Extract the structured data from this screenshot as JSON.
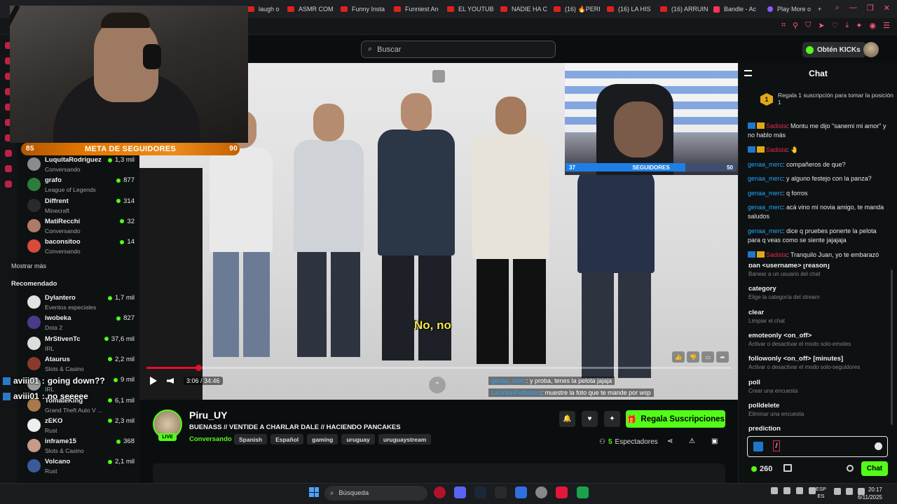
{
  "browser": {
    "tabs": [
      {
        "label": "laugh o",
        "icon": "youtube-icon"
      },
      {
        "label": "ASMR COM",
        "icon": "youtube-icon"
      },
      {
        "label": "Funny Insta",
        "icon": "youtube-icon"
      },
      {
        "label": "Funniest An",
        "icon": "youtube-icon"
      },
      {
        "label": "EL YOUTUB",
        "icon": "youtube-icon"
      },
      {
        "label": "NADIE HA C",
        "icon": "youtube-icon"
      },
      {
        "label": "(16) 🔥PERI",
        "icon": "youtube-icon"
      },
      {
        "label": "(16) LA HIS",
        "icon": "youtube-icon"
      },
      {
        "label": "(16) ARRUIN",
        "icon": "youtube-icon"
      },
      {
        "label": "Bandle - Ac",
        "icon": "bandle-icon"
      },
      {
        "label": "Play More o",
        "icon": "play-icon"
      }
    ],
    "new_tab": "+"
  },
  "header": {
    "search_placeholder": "Buscar",
    "kicks_button": "Obtén KICKs"
  },
  "overlay": {
    "goal_label": "META DE SEGUIDORES",
    "goal_current": "85",
    "goal_target": "90",
    "chat_lines": [
      {
        "user": "aviii01",
        "text": "going down??"
      },
      {
        "user": "aviii01",
        "text": "no seeeee"
      }
    ]
  },
  "sidebar": {
    "following": [
      {
        "name": "LuquitaRodriguez",
        "category": "Conversando",
        "viewers": "1,3 mil"
      },
      {
        "name": "grafo",
        "category": "League of Legends",
        "viewers": "877"
      },
      {
        "name": "Diffrent",
        "category": "Minecraft",
        "viewers": "314"
      },
      {
        "name": "MatiRecchi",
        "category": "Conversando",
        "viewers": "32"
      },
      {
        "name": "baconsitoo",
        "category": "Conversando",
        "viewers": "14"
      }
    ],
    "show_more": "Mostrar más",
    "recommended_title": "Recomendado",
    "recommended": [
      {
        "name": "Dylantero",
        "category": "Eventos especiales",
        "viewers": "1,7 mil"
      },
      {
        "name": "iwobeka",
        "category": "Dota 2",
        "viewers": "827"
      },
      {
        "name": "MrStivenTc",
        "category": "IRL",
        "viewers": "37,6 mil"
      },
      {
        "name": "Ataurus",
        "category": "Slots & Casino",
        "viewers": "2,2 mil"
      },
      {
        "name": "",
        "category": "IRL",
        "viewers": "9 mil"
      },
      {
        "name": "TomateKing",
        "category": "Grand Theft Auto V ...",
        "viewers": "6,1 mil"
      },
      {
        "name": "zEKO",
        "category": "Rust",
        "viewers": "2,3 mil"
      },
      {
        "name": "inframe15",
        "category": "Slots & Casino",
        "viewers": "368"
      },
      {
        "name": "Volcano",
        "category": "Rust",
        "viewers": "2,1 mil"
      }
    ]
  },
  "video": {
    "subtitle": "No, no",
    "time": "3:06 / 34:46",
    "progress": 0.089,
    "pip_label": "SEGUIDORES",
    "pip_low": "37",
    "pip_high": "50",
    "pip_fill": 0.7,
    "chat_lines": [
      {
        "user": "genaa_merc",
        "text": ": y proba, tenes la pelota jajaja"
      },
      {
        "user": "LaUnionFutbolera",
        "text": ": muestre la foto que te mande por wsp"
      }
    ]
  },
  "channel": {
    "name": "Piru_UY",
    "live": "LIVE",
    "title": "BUENASS // VENTIDE A CHARLAR DALE // HACIENDO PANCAKES",
    "category": "Conversando",
    "tags": [
      "Spanish",
      "Español",
      "gaming",
      "uruguay",
      "uruguaystream"
    ],
    "subscribe_gift": "Regala Suscripciones",
    "viewers_count": "5",
    "viewers_label": "Espectadores"
  },
  "chat": {
    "title": "Chat",
    "gift_rank": "1",
    "gift_prompt": "Regala 1 suscripción para tomar la posición 1",
    "messages": [
      {
        "user": "Sadista",
        "text": ": Montu me dijo \"sanemi mi amor\" y no hablo más",
        "badge": true
      },
      {
        "user": "Sadista",
        "text": ": 🤚",
        "badge": true
      },
      {
        "user": "genaa_merc",
        "text": ": compañeros de que?",
        "badge": false
      },
      {
        "user": "genaa_merc",
        "text": ": y alguno festejo con la panza?",
        "badge": false
      },
      {
        "user": "genaa_merc",
        "text": ": q forros",
        "badge": false
      },
      {
        "user": "genaa_merc",
        "text": ": acá vino mi novia amigo, te manda saludos",
        "badge": false
      },
      {
        "user": "genaa_merc",
        "text": ": dice q pruebes ponerte la pelota para q veas como se siente jajajaja",
        "badge": false
      },
      {
        "user": "Sadista",
        "text": ": Tranquilo Juan, yo te embarazó",
        "badge": true
      }
    ],
    "commands": [
      {
        "name": "ban <username> [reason]",
        "desc": "Banear a un usuario del chat"
      },
      {
        "name": "category",
        "desc": "Elige la categoría del stream"
      },
      {
        "name": "clear",
        "desc": "Limpiar el chat"
      },
      {
        "name": "emoteonly <on_off>",
        "desc": "Activar o desactivar el modo solo-emotes"
      },
      {
        "name": "followonly <on_off> [minutes]",
        "desc": "Activar o desactivar el modo solo-seguidores"
      },
      {
        "name": "poll",
        "desc": "Crear una encuesta"
      },
      {
        "name": "polldelete",
        "desc": "Eliminar una encuesta"
      },
      {
        "name": "prediction",
        "desc": ""
      }
    ],
    "input_value": "/",
    "kicks": "260",
    "send_label": "Chat"
  },
  "taskbar": {
    "search_placeholder": "Búsqueda",
    "lang_top": "ESP",
    "lang_bottom": "ES",
    "time": "20:17",
    "date": "6/11/2025"
  },
  "colors": {
    "kick_green": "#53fc18",
    "goal_orange": "#e47700",
    "username_blue": "#1ea7ff",
    "username_red": "#e6264a"
  }
}
